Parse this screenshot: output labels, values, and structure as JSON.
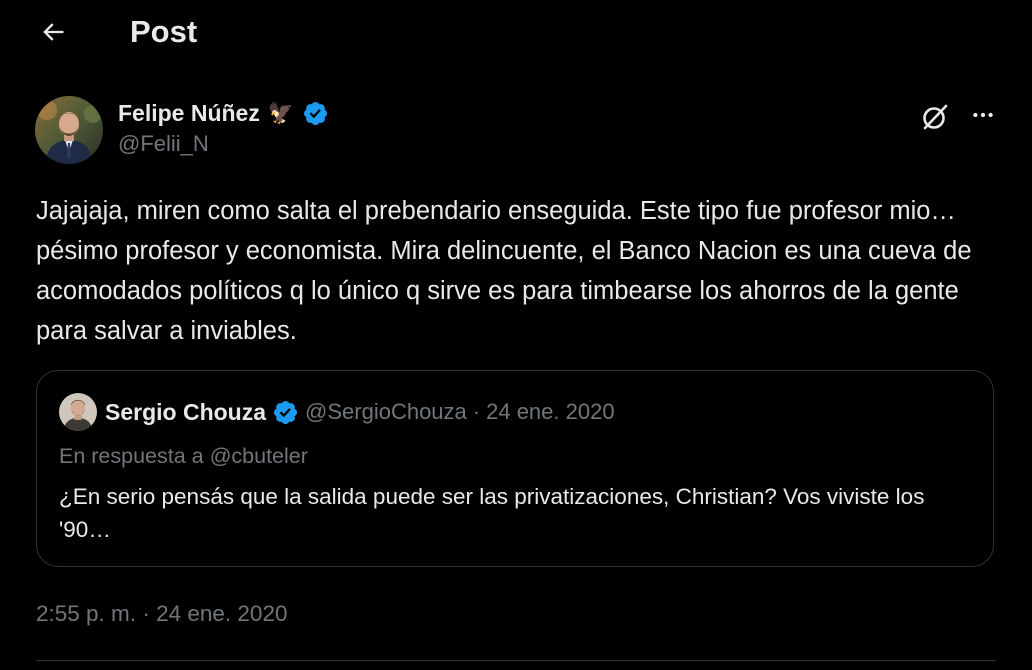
{
  "header": {
    "title": "Post",
    "back_icon": "arrow-left-icon"
  },
  "post": {
    "author": {
      "name": "Felipe Núñez",
      "emoji": "🦅",
      "verified": true,
      "handle": "@Felii_N"
    },
    "actions": {
      "grok_icon": "grok-icon",
      "more_icon": "more-horizontal-icon"
    },
    "text": "Jajajaja, miren como salta el prebendario enseguida. Este tipo fue profesor mio… pésimo profesor y economista. Mira delincuente, el Banco Nacion es una cueva de acomodados políticos q lo único q sirve es para timbearse los ahorros de la gente para salvar a inviables.",
    "timestamp": {
      "time": "2:55 p. m.",
      "separator": "·",
      "date": "24 ene. 2020"
    }
  },
  "quote": {
    "author": {
      "name": "Sergio Chouza",
      "verified": true,
      "handle": "@SergioChouza"
    },
    "separator": "·",
    "date": "24 ene. 2020",
    "reply_to": "En respuesta a @cbuteler",
    "text": "¿En serio pensás que la salida puede ser las privatizaciones, Christian? Vos viviste los '90…"
  },
  "colors": {
    "background": "#000000",
    "text_primary": "#e7e9ea",
    "text_secondary": "#71767b",
    "border": "#2f3336",
    "verified_blue": "#1d9bf0"
  }
}
